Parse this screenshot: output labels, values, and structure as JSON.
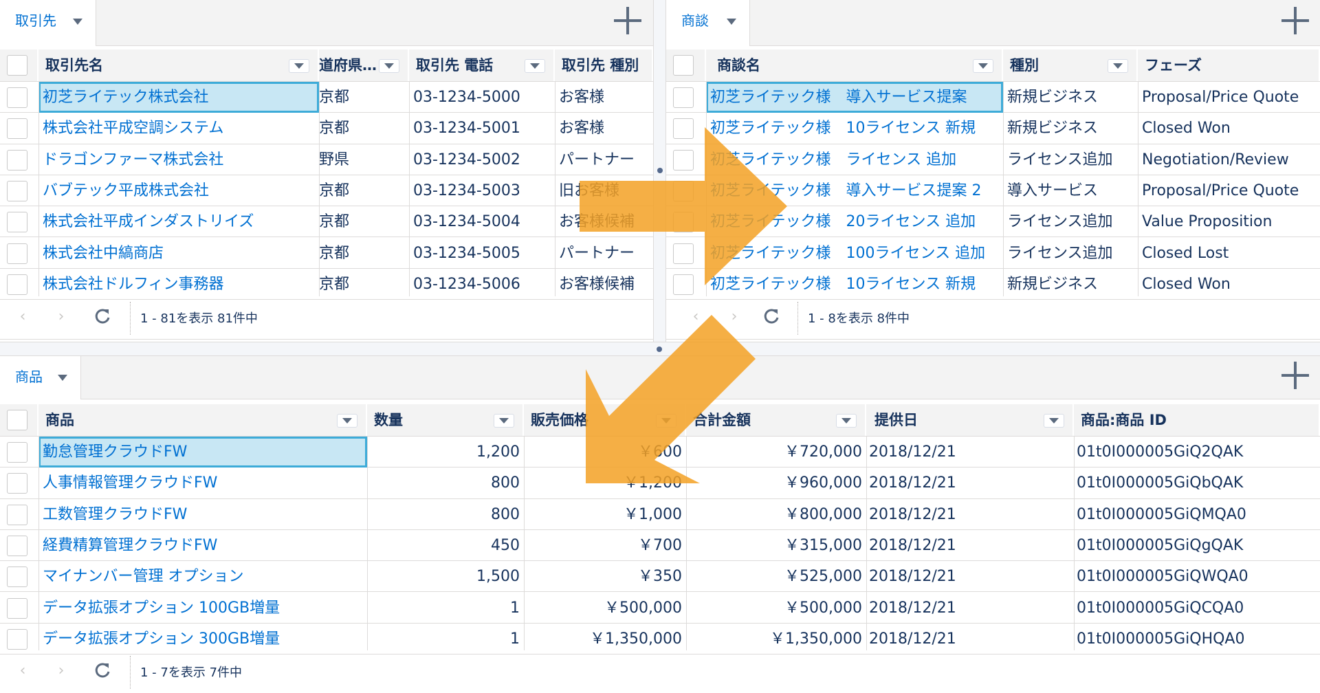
{
  "accounts": {
    "tab_label": "取引先",
    "columns": [
      "取引先名",
      "道府県…",
      "取引先 電話",
      "取引先 種別"
    ],
    "rows": [
      [
        "初芝ライテック株式会社",
        "京都",
        "03-1234-5000",
        "お客様"
      ],
      [
        "株式会社平成空調システム",
        "京都",
        "03-1234-5001",
        "お客様"
      ],
      [
        "ドラゴンファーマ株式会社",
        "野県",
        "03-1234-5002",
        "パートナー"
      ],
      [
        "バブテック平成株式会社",
        "京都",
        "03-1234-5003",
        "旧お客様"
      ],
      [
        "株式会社平成インダストリイズ",
        "京都",
        "03-1234-5004",
        "お客様候補"
      ],
      [
        "株式会社中縞商店",
        "京都",
        "03-1234-5005",
        "パートナー"
      ],
      [
        "株式会社ドルフィン事務器",
        "京都",
        "03-1234-5006",
        "お客様候補"
      ]
    ],
    "count": "1 - 81を表示 81件中"
  },
  "opportunities": {
    "tab_label": "商談",
    "columns": [
      "商談名",
      "種別",
      "フェーズ"
    ],
    "rows": [
      [
        "初芝ライテック様　導入サービス提案",
        "新規ビジネス",
        "Proposal/Price Quote"
      ],
      [
        "初芝ライテック様　10ライセンス 新規",
        "新規ビジネス",
        "Closed Won"
      ],
      [
        "初芝ライテック様　ライセンス 追加",
        "ライセンス追加",
        "Negotiation/Review"
      ],
      [
        "初芝ライテック様　導入サービス提案 2",
        "導入サービス",
        "Proposal/Price Quote"
      ],
      [
        "初芝ライテック様　20ライセンス 追加",
        "ライセンス追加",
        "Value Proposition"
      ],
      [
        "初芝ライテック様　100ライセンス 追加",
        "ライセンス追加",
        "Closed Lost"
      ],
      [
        "初芝ライテック様　10ライセンス 新規",
        "新規ビジネス",
        "Closed Won"
      ]
    ],
    "count": "1 - 8を表示 8件中"
  },
  "products": {
    "tab_label": "商品",
    "columns": [
      "商品",
      "数量",
      "販売価格",
      "合計金額",
      "提供日",
      "商品:商品 ID"
    ],
    "rows": [
      [
        "勤怠管理クラウドFW",
        "1,200",
        "￥600",
        "￥720,000",
        "2018/12/21",
        "01t0I000005GiQ2QAK"
      ],
      [
        "人事情報管理クラウドFW",
        "800",
        "￥1,200",
        "￥960,000",
        "2018/12/21",
        "01t0I000005GiQbQAK"
      ],
      [
        "工数管理クラウドFW",
        "800",
        "￥1,000",
        "￥800,000",
        "2018/12/21",
        "01t0I000005GiQMQA0"
      ],
      [
        "経費精算管理クラウドFW",
        "450",
        "￥700",
        "￥315,000",
        "2018/12/21",
        "01t0I000005GiQgQAK"
      ],
      [
        "マイナンバー管理 オプション",
        "1,500",
        "￥350",
        "￥525,000",
        "2018/12/21",
        "01t0I000005GiQWQA0"
      ],
      [
        "データ拡張オプション 100GB増量",
        "1",
        "￥500,000",
        "￥500,000",
        "2018/12/21",
        "01t0I000005GiQCQA0"
      ],
      [
        "データ拡張オプション 300GB増量",
        "1",
        "￥1,350,000",
        "￥1,350,000",
        "2018/12/21",
        "01t0I000005GiQHQA0"
      ]
    ],
    "count": "1 - 7を表示 7件中"
  },
  "icons": {
    "add": "plus-icon",
    "prev": "chevron-left-icon",
    "next": "chevron-right-icon",
    "refresh": "refresh-icon",
    "caret": "caret-down-icon",
    "flow_arrows": "arrow-right-icon, arrow-down-left-icon"
  },
  "colors": {
    "link": "#0070d2",
    "selected_bg": "#c8e7f4",
    "selected_border": "#3dabd8",
    "arrow": "#f3a124",
    "header_bg": "#f3f3f3"
  }
}
